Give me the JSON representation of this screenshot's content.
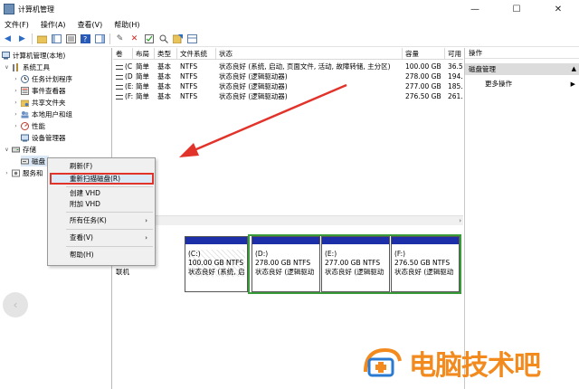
{
  "window": {
    "title": "计算机管理",
    "controls": {
      "minimize": "—",
      "maximize": "☐",
      "close": "✕"
    }
  },
  "menubar": [
    "文件(F)",
    "操作(A)",
    "查看(V)",
    "帮助(H)"
  ],
  "tree": {
    "root": "计算机管理(本地)",
    "system_tools": "系统工具",
    "task_scheduler": "任务计划程序",
    "event_viewer": "事件查看器",
    "shared_folders": "共享文件夹",
    "local_users": "本地用户和组",
    "performance": "性能",
    "device_manager": "设备管理器",
    "storage": "存储",
    "disk": "磁盘",
    "services": "服务和"
  },
  "table": {
    "headers": [
      "卷",
      "布局",
      "类型",
      "文件系统",
      "状态",
      "容量",
      "可用"
    ],
    "rows": [
      [
        "(C:)",
        "简单",
        "基本",
        "NTFS",
        "状态良好 (系统, 启动, 页面文件, 活动, 故障转储, 主分区)",
        "100.00 GB",
        "36.5("
      ],
      [
        "(D:)",
        "简单",
        "基本",
        "NTFS",
        "状态良好 (逻辑驱动器)",
        "278.00 GB",
        "194.("
      ],
      [
        "(E:)",
        "简单",
        "基本",
        "NTFS",
        "状态良好 (逻辑驱动器)",
        "277.00 GB",
        "185.("
      ],
      [
        "(F:)",
        "简单",
        "基本",
        "NTFS",
        "状态良好 (逻辑驱动器)",
        "276.50 GB",
        "261.("
      ]
    ]
  },
  "graph": {
    "disk_label": "联机",
    "partitions": [
      {
        "name": "(C:)",
        "size": "100.00 GB NTFS",
        "status": "状态良好 (系统, 启"
      },
      {
        "name": "(D:)",
        "size": "278.00 GB NTFS",
        "status": "状态良好 (逻辑驱动"
      },
      {
        "name": "(E:)",
        "size": "277.00 GB NTFS",
        "status": "状态良好 (逻辑驱动"
      },
      {
        "name": "(F:)",
        "size": "276.50 GB NTFS",
        "status": "状态良好 (逻辑驱动"
      }
    ]
  },
  "actions": {
    "header": "操作",
    "section": "磁盘管理",
    "more": "更多操作"
  },
  "context_menu": {
    "refresh": "刷新(F)",
    "rescan": "重新扫描磁盘(R)",
    "create_vhd": "创建 VHD",
    "attach_vhd": "附加 VHD",
    "all_tasks": "所有任务(K)",
    "view": "查看(V)",
    "help": "帮助(H)"
  },
  "watermark": "电脑技术吧",
  "colors": {
    "partition_bar": "#1c2fa8",
    "extended_border": "#3a9b3a",
    "highlight_border": "#e2332b",
    "watermark": "#f28a1e",
    "arrow": "#e2332b"
  }
}
